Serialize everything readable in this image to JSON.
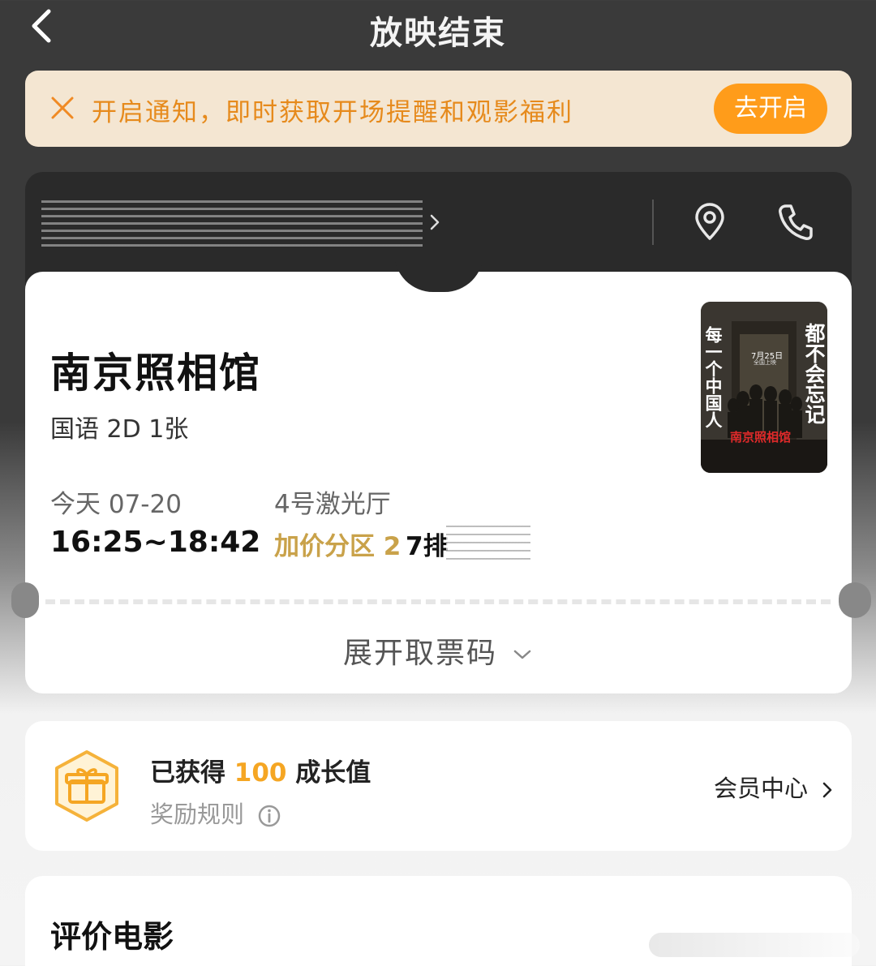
{
  "header": {
    "title": "放映结束",
    "back_icon": "chevron-left-icon"
  },
  "notify_bar": {
    "text": "开启通知，即时获取开场提醒和观影福利",
    "button_label": "去开启",
    "accent_color": "#ff9c1a",
    "text_color": "#e68a1c",
    "background": "#f4e6d2"
  },
  "cinema": {
    "icons": [
      "location-pin-icon",
      "phone-icon"
    ]
  },
  "ticket": {
    "movie_title": "南京照相馆",
    "format": "国语 2D 1张",
    "date": "今天 07-20",
    "time": "16:25~18:42",
    "hall": "4号激光厅",
    "seat_zone": "加价分区 2",
    "seat_row": "7排",
    "expand_label": "展开取票码",
    "zone_color": "#c9a24a"
  },
  "poster": {
    "left_text": "每一个中国人",
    "right_text": "都不会忘记",
    "date_text": "7月25日",
    "date_sub": "全国上映",
    "logo_text": "南京照相馆"
  },
  "reward": {
    "prefix": "已获得 ",
    "points": "100",
    "suffix": " 成长值",
    "rules_label": "奖励规则",
    "member_center_label": "会员中心",
    "points_color": "#f5a623"
  },
  "rate": {
    "title": "评价电影"
  }
}
